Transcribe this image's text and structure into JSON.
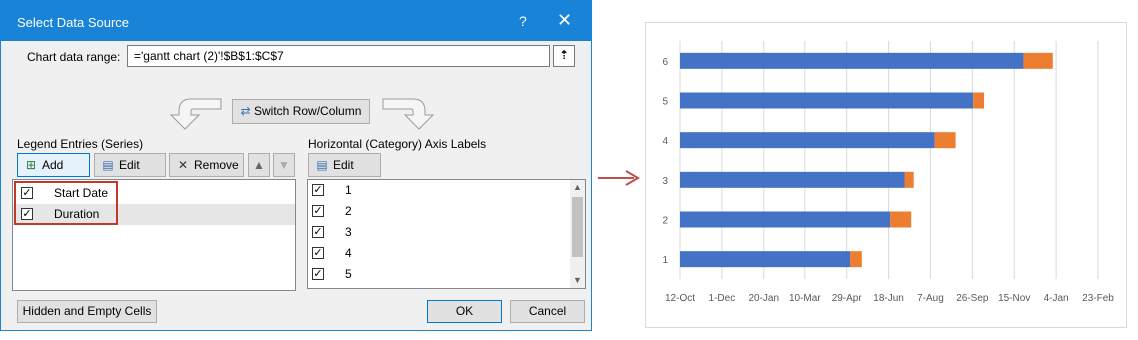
{
  "dialog": {
    "title": "Select Data Source",
    "help_glyph": "?",
    "close_glyph": "✕",
    "range_label": "Chart data range:",
    "range_value": "='gantt chart (2)'!$B$1:$C$7",
    "switch_label": "Switch Row/Column",
    "legend_header": "Legend Entries (Series)",
    "axis_header": "Horizontal (Category) Axis Labels",
    "add_label": "Add",
    "edit_label": "Edit",
    "remove_label": "Remove",
    "axis_edit_label": "Edit",
    "series": [
      {
        "name": "Start Date",
        "checked": true
      },
      {
        "name": "Duration",
        "checked": true
      }
    ],
    "categories": [
      {
        "label": "1",
        "checked": true
      },
      {
        "label": "2",
        "checked": true
      },
      {
        "label": "3",
        "checked": true
      },
      {
        "label": "4",
        "checked": true
      },
      {
        "label": "5",
        "checked": true
      }
    ],
    "hidden_cells_label": "Hidden and Empty Cells",
    "ok_label": "OK",
    "cancel_label": "Cancel"
  },
  "colors": {
    "titlebar": "#1883d7",
    "highlight_box": "#c0392b",
    "arrow": "#c0504d",
    "start_date_series": "#4472c4",
    "duration_series": "#ed7d31"
  },
  "chart_data": {
    "type": "bar",
    "orientation": "horizontal",
    "stacked": true,
    "categories": [
      "1",
      "2",
      "3",
      "4",
      "5",
      "6"
    ],
    "x_ticks": [
      "12-Oct",
      "1-Dec",
      "20-Jan",
      "10-Mar",
      "29-Apr",
      "18-Jun",
      "7-Aug",
      "26-Sep",
      "15-Nov",
      "4-Jan",
      "23-Feb"
    ],
    "xlim": [
      "12-Oct",
      "23-Feb"
    ],
    "series": [
      {
        "name": "Start Date",
        "values": [
          "3-May",
          "20-Jun",
          "7-Jul",
          "12-Aug",
          "27-Sep",
          "26-Nov"
        ]
      },
      {
        "name": "Duration",
        "values": [
          14,
          25,
          11,
          25,
          13,
          35
        ]
      }
    ],
    "grid": true,
    "legend": "none"
  }
}
